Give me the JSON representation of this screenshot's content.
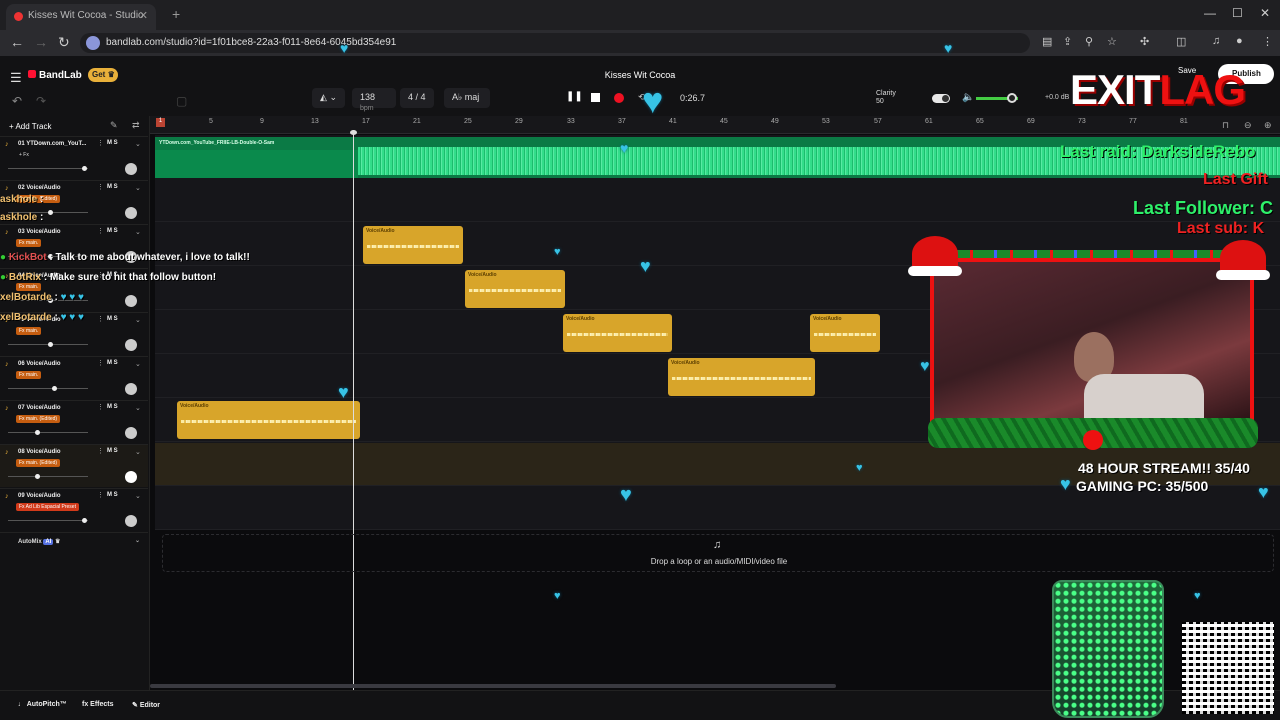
{
  "browser": {
    "tab_title": "Kisses Wit Cocoa - Studio",
    "url": "bandlab.com/studio?id=1f01bce8-22a3-f011-8e64-6045bd354e91"
  },
  "app": {
    "brand": "BandLab",
    "get_label": "Get",
    "project_title": "Kisses Wit Cocoa",
    "bpm": "138",
    "bpm_unit": "bpm",
    "time_signature": "4 / 4",
    "key": "A♭ maj",
    "timecode": "0:26.7",
    "clarity_label": "Clarity",
    "clarity_value": "50",
    "volume_db": "+0.0 dB",
    "save_label": "Save",
    "publish_label": "Publish"
  },
  "ruler": {
    "ticks": [
      "1",
      "5",
      "9",
      "13",
      "17",
      "21",
      "25",
      "29",
      "33",
      "37",
      "41",
      "45",
      "49",
      "53",
      "57",
      "61",
      "65",
      "69",
      "73",
      "77",
      "81"
    ]
  },
  "tracks_panel": {
    "add_track_label": "+ Add Track",
    "tracks": [
      {
        "name": "01 YTDown.com_YouT...",
        "fx": "+ Fx",
        "vol": 0.95
      },
      {
        "name": "02 Voice/Audio",
        "fx": "Fx main. (Edited)",
        "vol": 0.5
      },
      {
        "name": "03 Voice/Audio",
        "fx": "Fx main.",
        "vol": 0.5
      },
      {
        "name": "04 Voice/Audio",
        "fx": "Fx main.",
        "vol": 0.5
      },
      {
        "name": "05 Voice/Audio",
        "fx": "Fx main.",
        "vol": 0.5
      },
      {
        "name": "06 Voice/Audio",
        "fx": "Fx main.",
        "vol": 0.6
      },
      {
        "name": "07 Voice/Audio",
        "fx": "Fx main. (Edited)",
        "vol": 0.38
      },
      {
        "name": "08 Voice/Audio",
        "fx": "Fx main. (Edited)",
        "vol": 0.38
      },
      {
        "name": "09 Voice/Audio",
        "fx": "Fx Ad Lib Espacial Preset",
        "vol": 0.95
      }
    ],
    "mute_solo": "M  S",
    "automix_label": "AutoMix",
    "automix_ai": "AI"
  },
  "arrange": {
    "main_region_label": "YTDown.com_YouTube_FRIIE-LB-Double-O-Sam",
    "region_label": "Voice/Audio"
  },
  "dropzone": {
    "text": "Drop a loop or an audio/MIDI/video file"
  },
  "bottombar": {
    "autopitch": "AutoPitch™",
    "effects": "Effects",
    "editor": "Editor"
  },
  "overlay": {
    "chat": [
      {
        "nick": "askhole",
        "msg": ":"
      },
      {
        "nick": "askhole",
        "msg": ":"
      },
      {
        "nick": "KickBot",
        "msg": ": Talk to me about whatever, i love to talk!!"
      },
      {
        "nick": "BotRix",
        "msg": ": Make sure to hit that follow button!"
      },
      {
        "nick": "xelBotarde",
        "msg": ":"
      },
      {
        "nick": "xelBotarde",
        "msg": ":"
      }
    ],
    "exit": "EXIT",
    "lag": "LAG",
    "last_raid": "Last raid: DarksideRebo",
    "last_gift": "Last Gift",
    "last_follower": "Last Follower: C",
    "last_sub": "Last sub: K",
    "stream_goal": "48 HOUR STREAM!! 35/40",
    "pc_goal": "GAMING PC: 35/500"
  }
}
